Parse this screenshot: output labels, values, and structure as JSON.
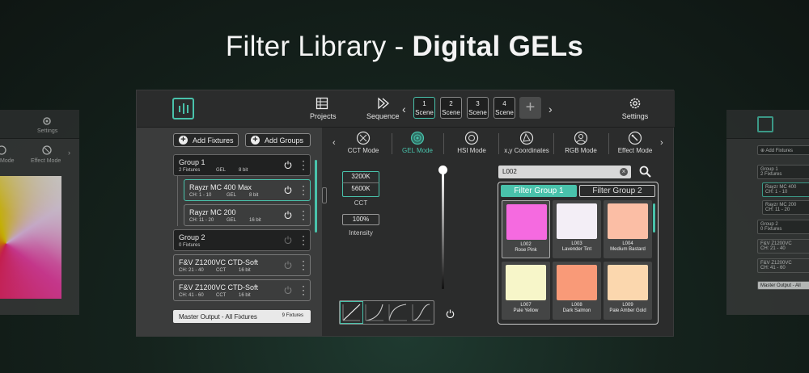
{
  "headline": {
    "light": "Filter Library - ",
    "bold": "Digital GELs"
  },
  "colors": {
    "accent": "#49c2ab",
    "panel": "#2b2c2c",
    "sidebar": "#3b3c3c"
  },
  "left_ghost": {
    "settings_label": "Settings",
    "mode1": "Mode",
    "mode2": "Effect Mode"
  },
  "right_ghost": {
    "add_label": "Add Fixtures",
    "items": [
      {
        "name": "Group 1",
        "sub": "2 Fixtures"
      },
      {
        "name": "Rayzr MC 400",
        "sub": "CH: 1 - 10"
      },
      {
        "name": "Rayzr MC 200",
        "sub": "CH: 11 - 20"
      },
      {
        "name": "Group 2",
        "sub": "0 Fixtures"
      },
      {
        "name": "F&V Z1200VC",
        "sub": "CH: 21 - 40"
      },
      {
        "name": "F&V Z1200VC",
        "sub": "CH: 41 - 60"
      }
    ],
    "master": "Master Output - All"
  },
  "topbar": {
    "projects": "Projects",
    "sequence": "Sequence",
    "settings": "Settings",
    "scene_word": "Scene",
    "scenes": [
      "1",
      "2",
      "3",
      "4"
    ],
    "add_scene": "+",
    "prev": "‹",
    "next": "›"
  },
  "sidebar": {
    "add_fixtures": "Add Fixtures",
    "add_groups": "Add Groups",
    "fixtures": [
      {
        "name": "Group 1",
        "info": "2 Fixtures",
        "mode": "GEL",
        "bits": "8 bit"
      },
      {
        "name": "Rayzr MC 400 Max",
        "info": "CH: 1 - 10",
        "mode": "GEL",
        "bits": "8 bit"
      },
      {
        "name": "Rayzr MC 200",
        "info": "CH: 11 - 20",
        "mode": "GEL",
        "bits": "16 bit"
      },
      {
        "name": "Group 2",
        "info": "0 Fixtures",
        "mode": "",
        "bits": ""
      },
      {
        "name": "F&V Z1200VC CTD-Soft",
        "info": "CH: 21 - 40",
        "mode": "CCT",
        "bits": "16 bit"
      },
      {
        "name": "F&V Z1200VC CTD-Soft",
        "info": "CH: 41 - 60",
        "mode": "CCT",
        "bits": "16 bit"
      }
    ],
    "master_label": "Master Output - All Fixtures",
    "master_count": "9 Fixtures"
  },
  "modes": {
    "items": [
      "CCT Mode",
      "GEL Mode",
      "HSI Mode",
      "x,y Coordinates",
      "RGB Mode",
      "Effect Mode"
    ],
    "active": "GEL Mode",
    "prev": "‹",
    "next": "›"
  },
  "cct": {
    "values": [
      "3200K",
      "5600K"
    ],
    "label": "CCT"
  },
  "intensity": {
    "value": "100%",
    "label": "Intensity"
  },
  "search": {
    "value": "L002",
    "clear": "×"
  },
  "library": {
    "tabs": [
      "Filter Group 1",
      "Filter Group 2"
    ],
    "active_tab": "Filter Group 1",
    "gels": [
      {
        "code": "L002",
        "name": "Rose Pink",
        "color": "#f56ae0",
        "selected": true
      },
      {
        "code": "L003",
        "name": "Lavender Tint",
        "color": "#f3eef6",
        "selected": false
      },
      {
        "code": "L004",
        "name": "Medium Bastard",
        "color": "#fbbea5",
        "selected": false
      },
      {
        "code": "L007",
        "name": "Pale Yellow",
        "color": "#f7f6c9",
        "selected": false
      },
      {
        "code": "L008",
        "name": "Dark Salmon",
        "color": "#f99a78",
        "selected": false
      },
      {
        "code": "L009",
        "name": "Pale Amber Gold",
        "color": "#fbd7ae",
        "selected": false
      }
    ]
  }
}
